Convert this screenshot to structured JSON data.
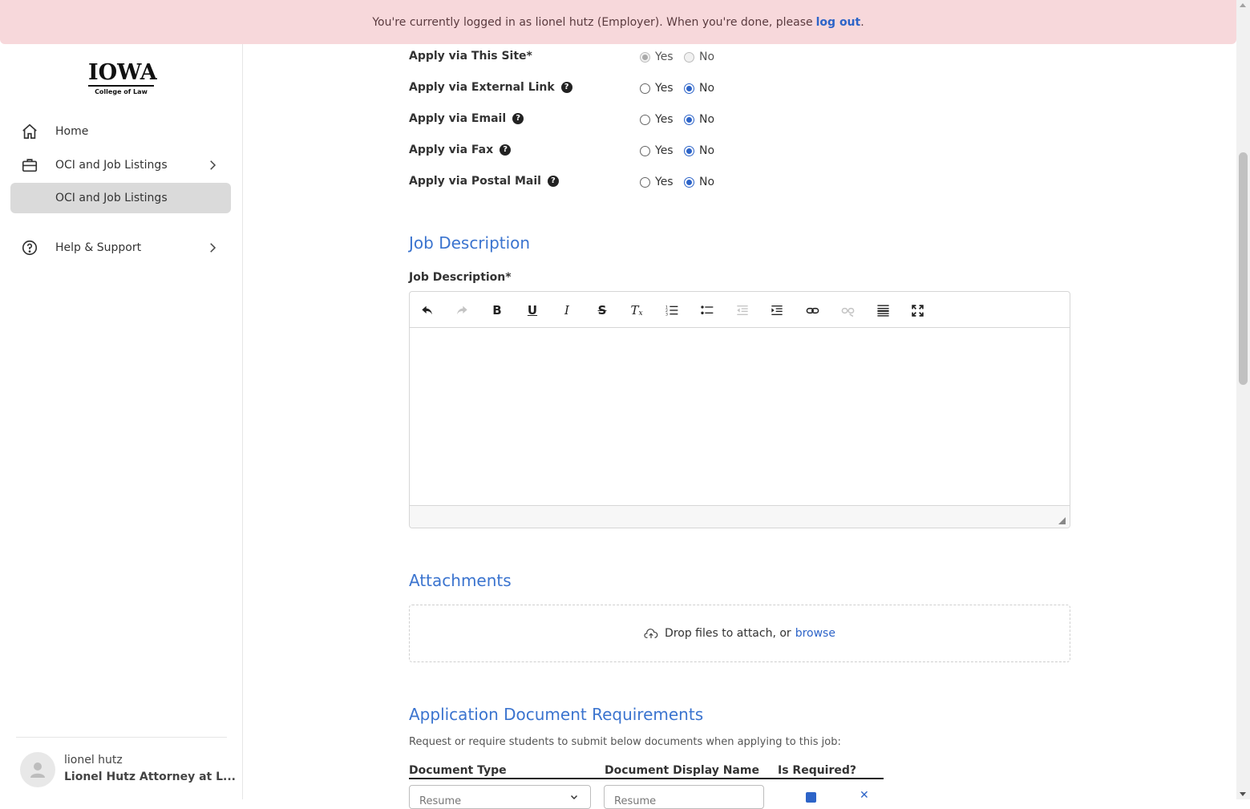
{
  "banner": {
    "text": "You're currently logged in as lionel hutz (Employer). When you're done, please",
    "logout_link": "log out",
    "period": "."
  },
  "sidebar": {
    "logo_big": "IOWA",
    "logo_small": "College of Law",
    "items": [
      {
        "label": "Home",
        "icon": "home-icon"
      },
      {
        "label": "OCI and Job Listings",
        "icon": "briefcase-icon"
      },
      {
        "label": "OCI and Job Listings"
      },
      {
        "label": "Help & Support",
        "icon": "question-circle-icon"
      }
    ],
    "user": {
      "name": "lionel hutz",
      "org": "Lionel Hutz Attorney at L..."
    }
  },
  "apply": {
    "rows": [
      {
        "label": "Apply via This Site*",
        "yes": "Yes",
        "no": "No",
        "selected": "Yes",
        "disabled": true,
        "help": false
      },
      {
        "label": "Apply via External Link",
        "yes": "Yes",
        "no": "No",
        "selected": "No",
        "help": true
      },
      {
        "label": "Apply via Email",
        "yes": "Yes",
        "no": "No",
        "selected": "No",
        "help": true
      },
      {
        "label": "Apply via Fax",
        "yes": "Yes",
        "no": "No",
        "selected": "No",
        "help": true
      },
      {
        "label": "Apply via Postal Mail",
        "yes": "Yes",
        "no": "No",
        "selected": "No",
        "help": true
      }
    ]
  },
  "job_description": {
    "heading": "Job Description",
    "label": "Job Description*",
    "toolbar": [
      "undo-icon",
      "redo-icon",
      "bold-icon",
      "underline-icon",
      "italic-icon",
      "strikethrough-icon",
      "clear-format-icon",
      "ordered-list-icon",
      "bullet-list-icon",
      "outdent-icon",
      "indent-icon",
      "link-icon",
      "unlink-icon",
      "horizontal-rule-icon",
      "fullscreen-icon"
    ]
  },
  "attachments": {
    "heading": "Attachments",
    "drop_text": "Drop files to attach, or",
    "browse": "browse"
  },
  "requirements": {
    "heading": "Application Document Requirements",
    "description": "Request or require students to submit below documents when applying to this job:",
    "columns": [
      "Document Type",
      "Document Display Name",
      "Is Required?"
    ],
    "row": {
      "type": "Resume",
      "display_name": "Resume",
      "required": true
    }
  },
  "colors": {
    "accent": "#3b74cf",
    "banner_bg": "#f7d8db"
  }
}
